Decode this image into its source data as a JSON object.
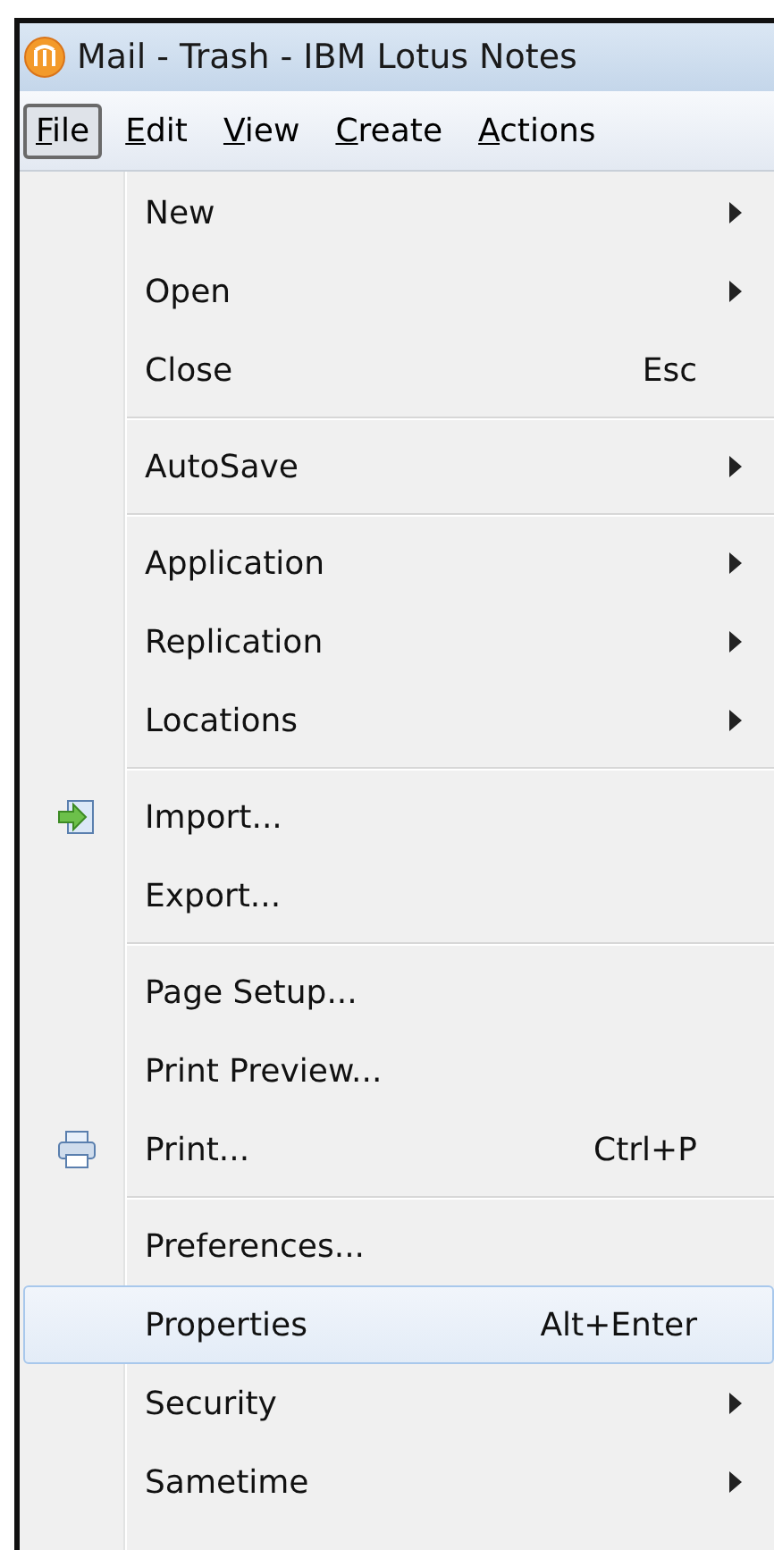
{
  "window": {
    "title": "Mail - Trash - IBM Lotus Notes"
  },
  "menu_bar": [
    {
      "label": "File",
      "selected": true
    },
    {
      "label": "Edit",
      "selected": false
    },
    {
      "label": "View",
      "selected": false
    },
    {
      "label": "Create",
      "selected": false
    },
    {
      "label": "Actions",
      "selected": false
    }
  ],
  "menu": [
    {
      "kind": "item",
      "label": "New",
      "submenu": true,
      "selected": false
    },
    {
      "kind": "item",
      "label": "Open",
      "submenu": true,
      "selected": false
    },
    {
      "kind": "item",
      "label": "Close",
      "shortcut": "Esc",
      "selected": false
    },
    {
      "kind": "separator"
    },
    {
      "kind": "item",
      "label": "AutoSave",
      "submenu": true,
      "selected": false
    },
    {
      "kind": "separator"
    },
    {
      "kind": "item",
      "label": "Application",
      "submenu": true,
      "selected": false
    },
    {
      "kind": "item",
      "label": "Replication",
      "submenu": true,
      "selected": false
    },
    {
      "kind": "item",
      "label": "Locations",
      "submenu": true,
      "selected": false
    },
    {
      "kind": "separator"
    },
    {
      "kind": "item",
      "label": "Import...",
      "selected": false
    },
    {
      "kind": "item",
      "label": "Export...",
      "selected": false
    },
    {
      "kind": "separator"
    },
    {
      "kind": "item",
      "label": "Page Setup...",
      "selected": false
    },
    {
      "kind": "item",
      "label": "Print Preview...",
      "selected": false
    },
    {
      "kind": "item",
      "label": "Print...",
      "shortcut": "Ctrl+P",
      "selected": false
    },
    {
      "kind": "separator"
    },
    {
      "kind": "item",
      "label": "Preferences...",
      "selected": false
    },
    {
      "kind": "item",
      "label": "Properties",
      "shortcut": "Alt+Enter",
      "selected": true
    },
    {
      "kind": "item",
      "label": "Security",
      "submenu": true,
      "selected": false
    },
    {
      "kind": "item",
      "label": "Sametime",
      "submenu": true,
      "selected": false
    }
  ]
}
